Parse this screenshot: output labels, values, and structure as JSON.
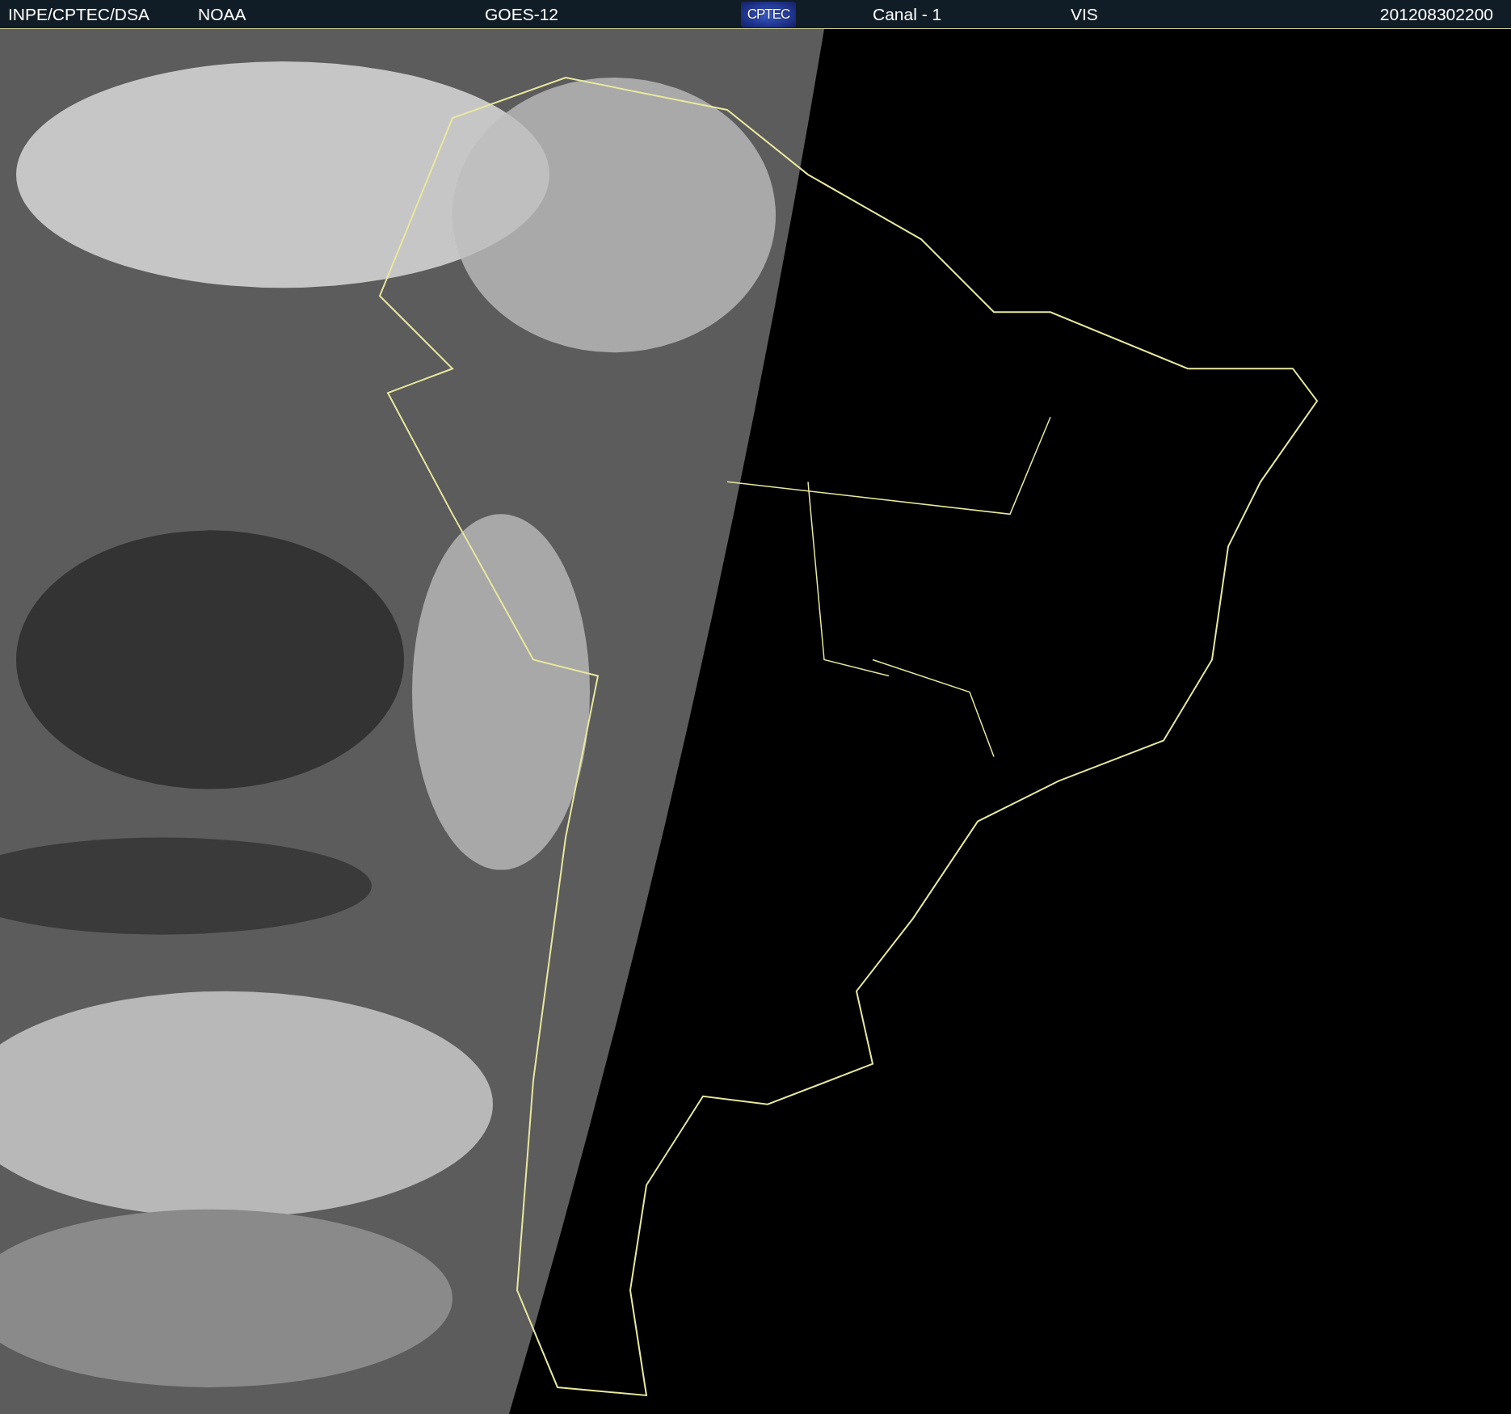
{
  "header": {
    "items": [
      "INPE/CPTEC/DSA",
      "NOAA",
      "GOES-12"
    ],
    "logo": "CPTEC",
    "items_after_logo": [
      "Canal - 1",
      "VIS"
    ],
    "timestamp": "201208302200"
  }
}
